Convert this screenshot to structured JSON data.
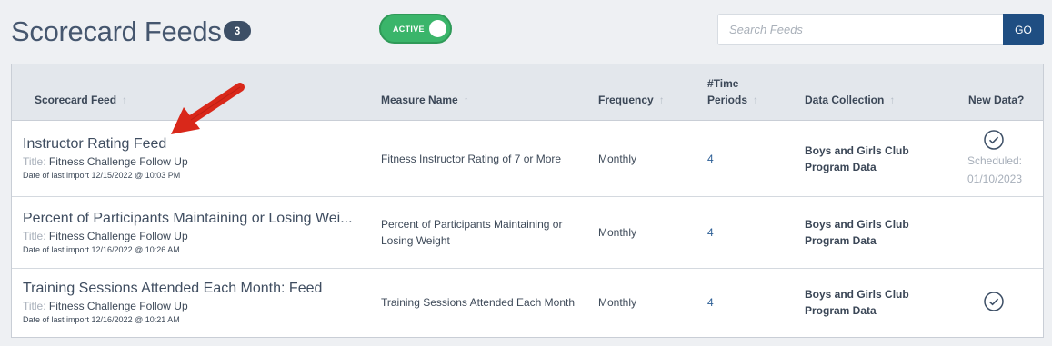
{
  "header": {
    "title": "Scorecard Feeds",
    "count": "3",
    "toggle_label": "ACTIVE",
    "search_placeholder": "Search Feeds",
    "go_label": "GO"
  },
  "table": {
    "columns": {
      "feed": "Scorecard Feed",
      "measure": "Measure Name",
      "frequency": "Frequency",
      "periods_line1": "#Time",
      "periods_line2": "Periods",
      "collection": "Data Collection",
      "new_data": "New Data?"
    },
    "sort_glyph": "↑",
    "title_prefix": "Title:",
    "rows": [
      {
        "name": "Instructor Rating Feed",
        "title": "Fitness Challenge Follow Up",
        "date": "Date of last import 12/15/2022 @ 10:03 PM",
        "measure_line1": "Fitness Instructor Rating of 7 or More",
        "measure_line2": "",
        "frequency": "Monthly",
        "periods": "4",
        "collection_line1": "Boys and Girls Club",
        "collection_line2": "Program Data",
        "scheduled_label": "Scheduled:",
        "scheduled_date": "01/10/2023"
      },
      {
        "name": "Percent of Participants Maintaining or Losing Wei...",
        "title": "Fitness Challenge Follow Up",
        "date": "Date of last import 12/16/2022 @ 10:26 AM",
        "measure_line1": "Percent of Participants Maintaining or",
        "measure_line2": "Losing Weight",
        "frequency": "Monthly",
        "periods": "4",
        "collection_line1": "Boys and Girls Club",
        "collection_line2": "Program Data"
      },
      {
        "name": "Training Sessions Attended Each Month: Feed",
        "title": "Fitness Challenge Follow Up",
        "date": "Date of last import 12/16/2022 @ 10:21 AM",
        "measure_line1": "Training Sessions Attended Each Month",
        "measure_line2": "",
        "frequency": "Monthly",
        "periods": "4",
        "collection_line1": "Boys and Girls Club",
        "collection_line2": "Program Data"
      }
    ]
  },
  "colors": {
    "accent": "#1f4e82",
    "toggle_on": "#3ab56a",
    "annotation_arrow": "#d9281a"
  },
  "icons": [
    "check-circle-icon",
    "sort-arrow-icon",
    "annotation-arrow-icon"
  ]
}
